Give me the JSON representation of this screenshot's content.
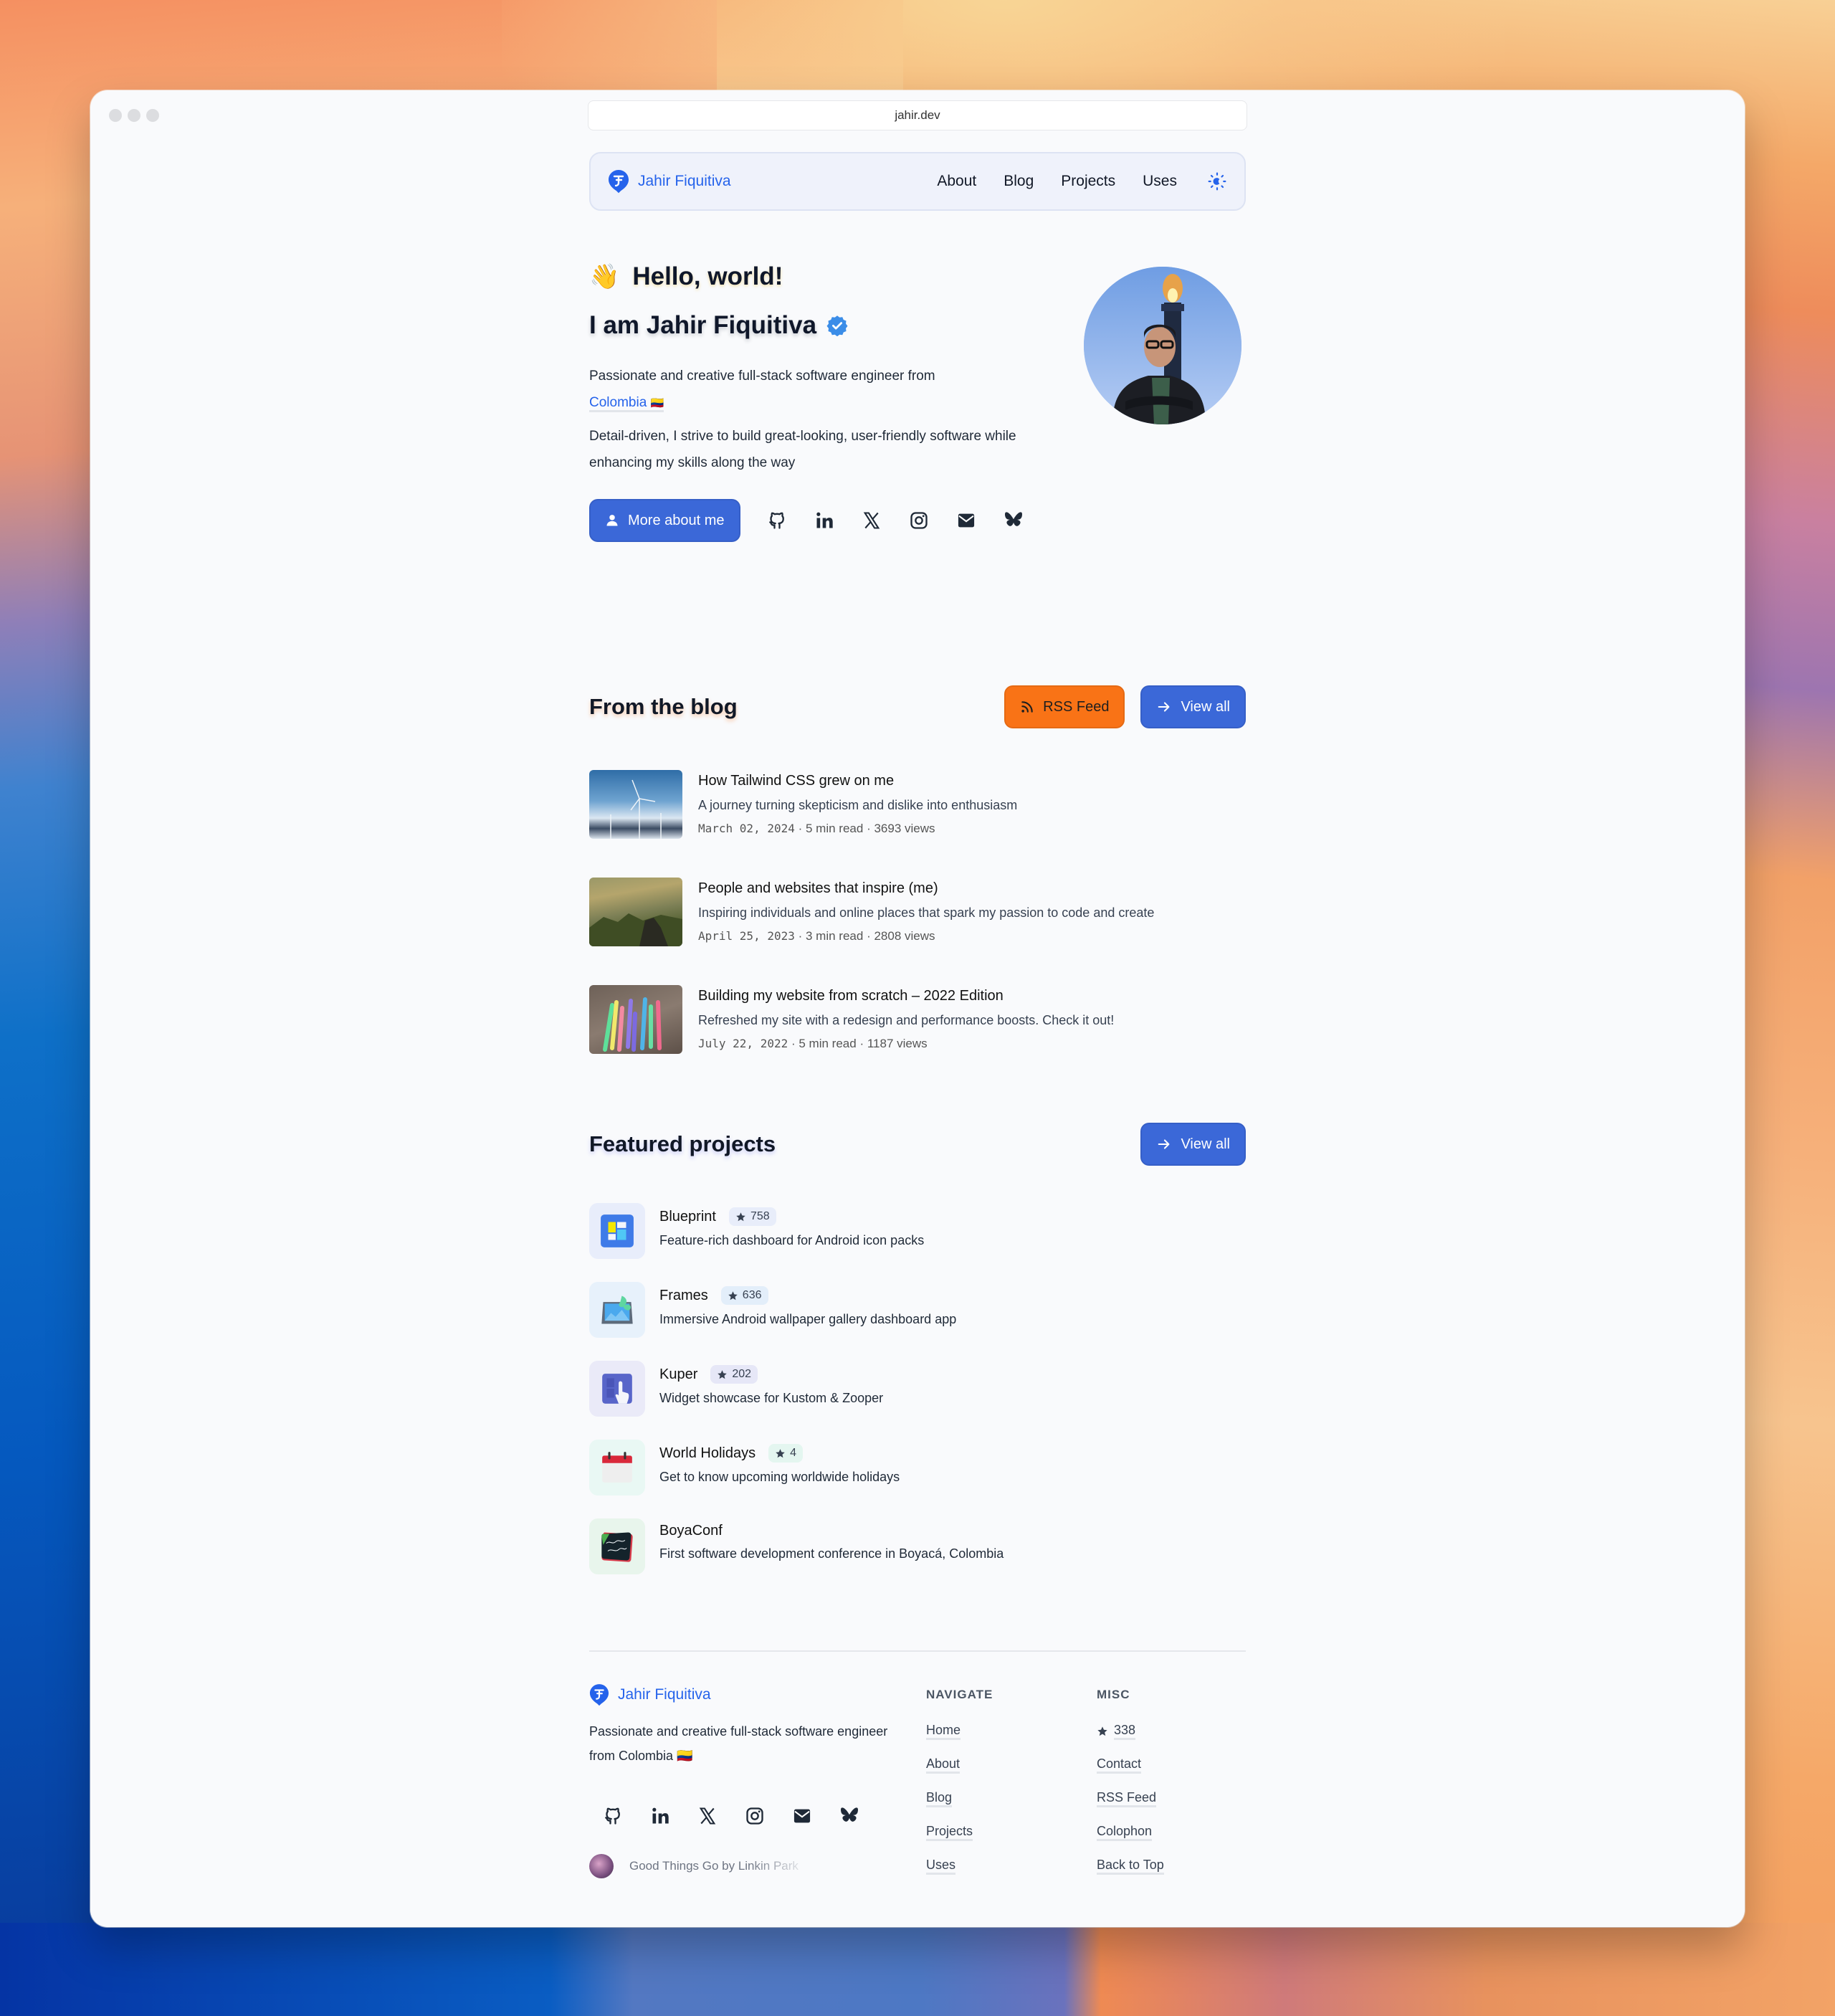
{
  "browser": {
    "url": "jahir.dev"
  },
  "nav": {
    "brand": "Jahir Fiquitiva",
    "links": [
      "About",
      "Blog",
      "Projects",
      "Uses"
    ],
    "theme_toggle_icon": "sun-moon-icon"
  },
  "hero": {
    "greeting_emoji": "👋",
    "greeting": "Hello, world!",
    "name_line": "I am Jahir Fiquitiva",
    "bio_prefix": "Passionate and creative full-stack software engineer from",
    "country_link": "Colombia",
    "flag": "🇨🇴",
    "bio2": "Detail-driven, I strive to build great-looking, user-friendly software while enhancing my skills along the way",
    "cta": "More about me",
    "social": [
      "github-icon",
      "linkedin-icon",
      "x-icon",
      "instagram-icon",
      "email-icon",
      "bluesky-icon"
    ]
  },
  "blog": {
    "heading": "From the blog",
    "rss_label": "RSS Feed",
    "view_all_label": "View all",
    "posts": [
      {
        "title": "How Tailwind CSS grew on me",
        "description": "A journey turning skepticism and dislike into enthusiasm",
        "date": "March 02, 2024",
        "read_time": "5 min read",
        "views": "3693 views"
      },
      {
        "title": "People and websites that inspire (me)",
        "description": "Inspiring individuals and online places that spark my passion to code and create",
        "date": "April 25, 2023",
        "read_time": "3 min read",
        "views": "2808 views"
      },
      {
        "title": "Building my website from scratch – 2022 Edition",
        "description": "Refreshed my site with a redesign and performance boosts. Check it out!",
        "date": "July 22, 2022",
        "read_time": "5 min read",
        "views": "1187 views"
      }
    ],
    "separator": "·"
  },
  "projects": {
    "heading": "Featured projects",
    "view_all_label": "View all",
    "items": [
      {
        "name": "Blueprint",
        "stars": "758",
        "description": "Feature-rich dashboard for Android icon packs",
        "tint": "#e8edfb"
      },
      {
        "name": "Frames",
        "stars": "636",
        "description": "Immersive Android wallpaper gallery dashboard app",
        "tint": "#e7f1fb"
      },
      {
        "name": "Kuper",
        "stars": "202",
        "description": "Widget showcase for Kustom & Zooper",
        "tint": "#eaeaf8"
      },
      {
        "name": "World Holidays",
        "stars": "4",
        "description": "Get to know upcoming worldwide holidays",
        "tint": "#e9f8f4"
      },
      {
        "name": "BoyaConf",
        "stars": null,
        "description": "First software development conference in Boyacá, Colombia",
        "tint": "#e8f5ec"
      }
    ]
  },
  "footer": {
    "brand": "Jahir Fiquitiva",
    "bio": "Passionate and creative full-stack software engineer from Colombia 🇨🇴",
    "now_playing": "Good Things Go by Linkin Park",
    "navigate": {
      "heading": "NAVIGATE",
      "links": [
        "Home",
        "About",
        "Blog",
        "Projects",
        "Uses"
      ]
    },
    "misc": {
      "heading": "MISC",
      "stars": "338",
      "links": [
        "Contact",
        "RSS Feed",
        "Colophon",
        "Back to Top"
      ]
    }
  },
  "colors": {
    "accent": "#2563eb",
    "button_blue": "#3b68d8",
    "rss_orange": "#f97316"
  }
}
